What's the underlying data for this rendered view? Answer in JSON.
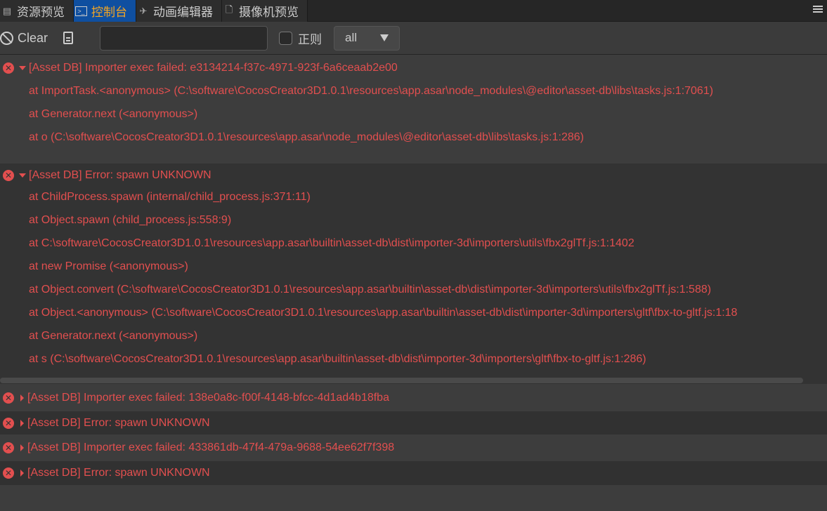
{
  "tabs": [
    {
      "label": "资源预览",
      "icon": "list-icon"
    },
    {
      "label": "控制台",
      "icon": "terminal-icon",
      "active": true
    },
    {
      "label": "动画编辑器",
      "icon": "runner-icon"
    },
    {
      "label": "摄像机预览",
      "icon": "file-icon"
    }
  ],
  "toolbar": {
    "clear_label": "Clear",
    "search_value": "",
    "regex_label": "正则",
    "filter_value": "all"
  },
  "logs": [
    {
      "title": "[Asset DB] Importer exec failed: e3134214-f37c-4971-923f-6a6ceaab2e00",
      "expanded": true,
      "stack": [
        "at ImportTask.<anonymous> (C:\\software\\CocosCreator3D1.0.1\\resources\\app.asar\\node_modules\\@editor\\asset-db\\libs\\tasks.js:1:7061)",
        "at Generator.next (<anonymous>)",
        "at o (C:\\software\\CocosCreator3D1.0.1\\resources\\app.asar\\node_modules\\@editor\\asset-db\\libs\\tasks.js:1:286)"
      ]
    },
    {
      "title": "[Asset DB] Error: spawn UNKNOWN",
      "expanded": true,
      "stack": [
        "at ChildProcess.spawn (internal/child_process.js:371:11)",
        "at Object.spawn (child_process.js:558:9)",
        "at C:\\software\\CocosCreator3D1.0.1\\resources\\app.asar\\builtin\\asset-db\\dist\\importer-3d\\importers\\utils\\fbx2glTf.js:1:1402",
        "at new Promise (<anonymous>)",
        "at Object.convert (C:\\software\\CocosCreator3D1.0.1\\resources\\app.asar\\builtin\\asset-db\\dist\\importer-3d\\importers\\utils\\fbx2glTf.js:1:588)",
        "at Object.<anonymous> (C:\\software\\CocosCreator3D1.0.1\\resources\\app.asar\\builtin\\asset-db\\dist\\importer-3d\\importers\\gltf\\fbx-to-gltf.js:1:18",
        "at Generator.next (<anonymous>)",
        "at s (C:\\software\\CocosCreator3D1.0.1\\resources\\app.asar\\builtin\\asset-db\\dist\\importer-3d\\importers\\gltf\\fbx-to-gltf.js:1:286)"
      ]
    },
    {
      "title": "[Asset DB] Importer exec failed: 138e0a8c-f00f-4148-bfcc-4d1ad4b18fba",
      "expanded": false
    },
    {
      "title": "[Asset DB] Error: spawn UNKNOWN",
      "expanded": false
    },
    {
      "title": "[Asset DB] Importer exec failed: 433861db-47f4-479a-9688-54ee62f7f398",
      "expanded": false
    },
    {
      "title": "[Asset DB] Error: spawn UNKNOWN",
      "expanded": false
    }
  ],
  "colors": {
    "error": "#e24f4f",
    "active_tab": "#0f4fa0",
    "active_tab_text": "#f5a623"
  }
}
